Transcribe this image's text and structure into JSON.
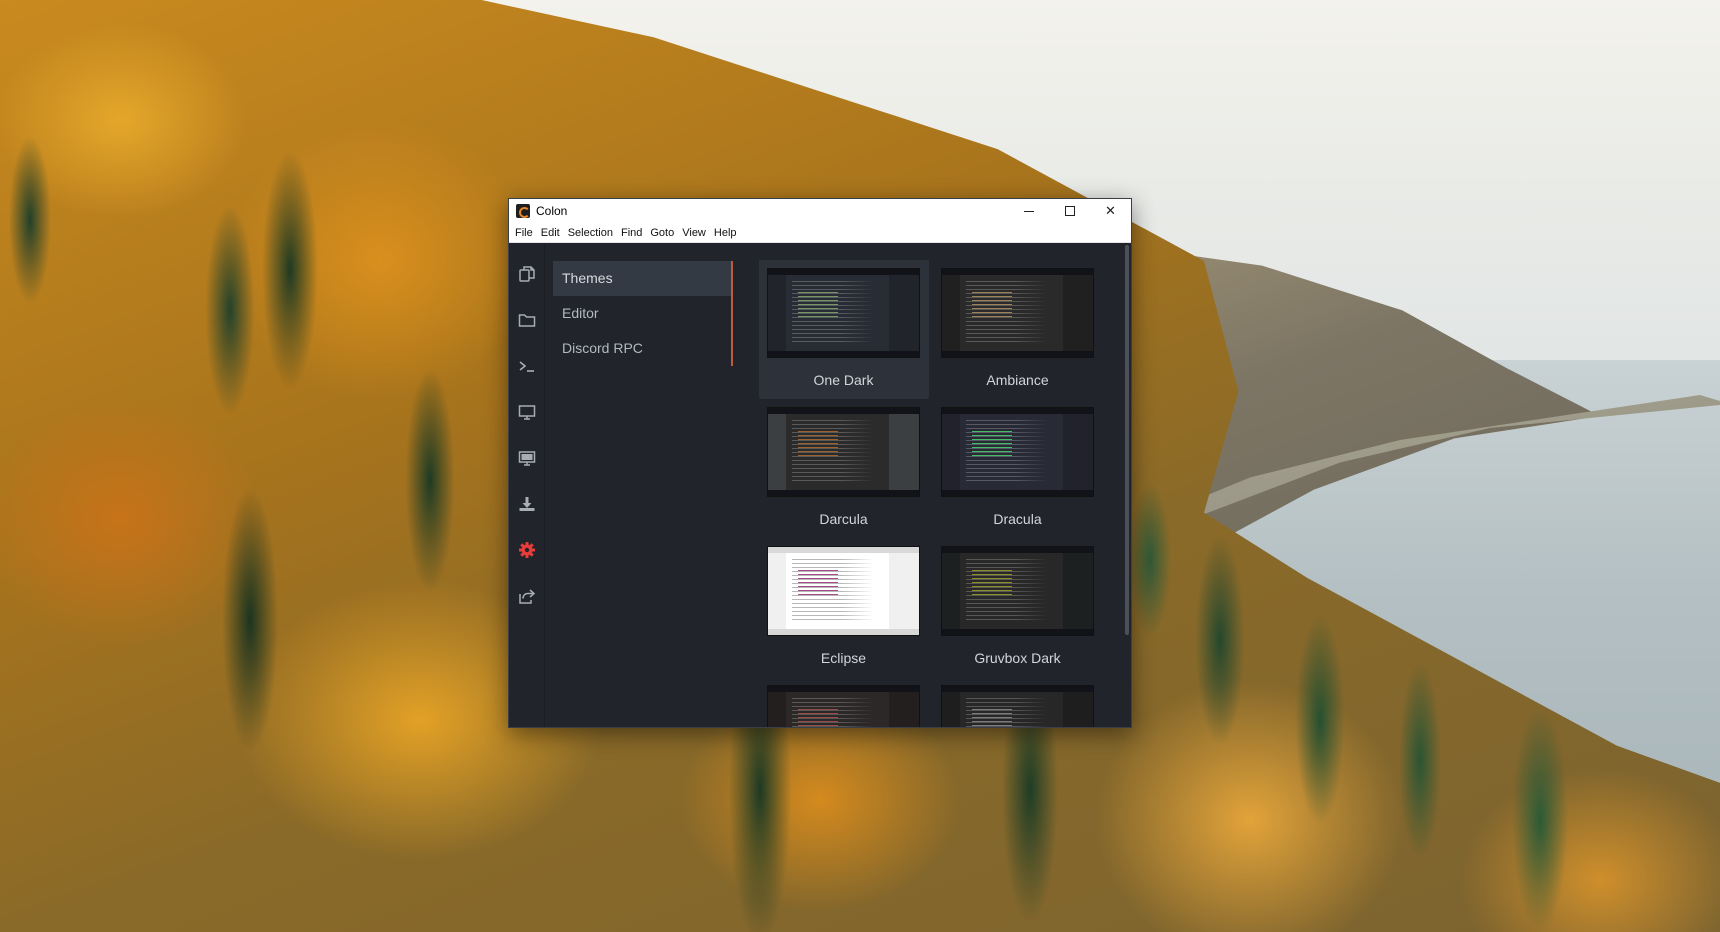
{
  "window": {
    "title": "Colon",
    "controls": {
      "minimize": "minimize",
      "maximize": "maximize",
      "close": "✕"
    }
  },
  "menu": [
    "File",
    "Edit",
    "Selection",
    "Find",
    "Goto",
    "View",
    "Help"
  ],
  "activity_bar": [
    {
      "icon": "copy-files-icon"
    },
    {
      "icon": "folder-icon"
    },
    {
      "icon": "terminal-icon"
    },
    {
      "icon": "monitor-icon"
    },
    {
      "icon": "display-icon"
    },
    {
      "icon": "download-icon"
    },
    {
      "icon": "gear-icon",
      "active": true,
      "color": "#e83b3b"
    },
    {
      "icon": "share-icon"
    }
  ],
  "settings_nav": {
    "items": [
      {
        "label": "Themes",
        "active": true
      },
      {
        "label": "Editor"
      },
      {
        "label": "Discord RPC"
      }
    ]
  },
  "themes": [
    {
      "name": "One Dark",
      "selected": true,
      "bg": "#282c34",
      "side": "#21252b",
      "accent": "#98c379"
    },
    {
      "name": "Ambiance",
      "bg": "#2a2a2a",
      "side": "#202020",
      "accent": "#cda869"
    },
    {
      "name": "Darcula",
      "bg": "#2b2b2b",
      "side": "#3c3f41",
      "accent": "#cc7832"
    },
    {
      "name": "Dracula",
      "bg": "#282a36",
      "side": "#21222c",
      "accent": "#50fa7b"
    },
    {
      "name": "Eclipse",
      "bg": "#ffffff",
      "side": "#f0f0f0",
      "accent": "#7f0055"
    },
    {
      "name": "Gruvbox Dark",
      "bg": "#282828",
      "side": "#1d2021",
      "accent": "#b8bb26"
    },
    {
      "name": "",
      "bg": "#2c2828",
      "side": "#231f1f",
      "accent": "#c45a5a"
    },
    {
      "name": "",
      "bg": "#272727",
      "side": "#1e1e1e",
      "accent": "#a0a0a0"
    }
  ],
  "colors": {
    "accent_divider": "#c25a3c",
    "panel_bg": "#21252b",
    "active_item": "#343a43"
  }
}
